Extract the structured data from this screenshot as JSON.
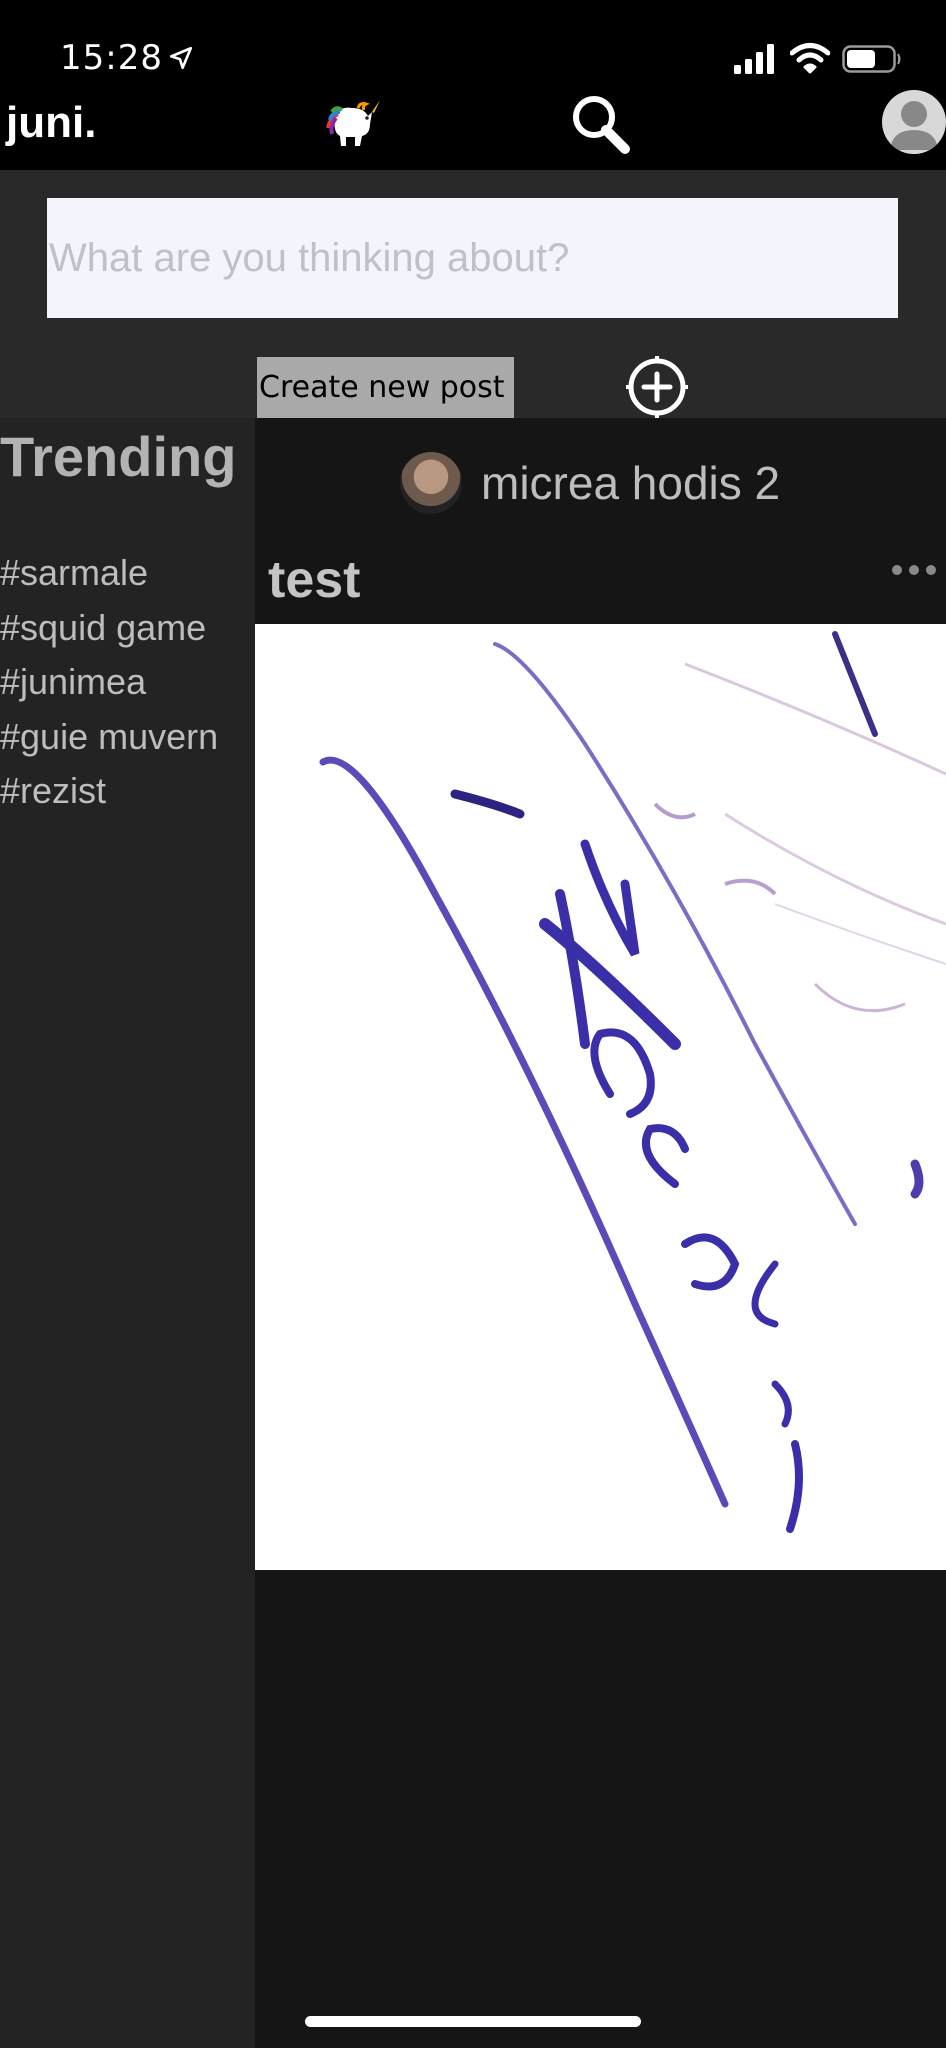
{
  "status_bar": {
    "time": "15:28"
  },
  "nav": {
    "brand": "juni."
  },
  "composer": {
    "placeholder": "What are you thinking about?",
    "create_label": "Create new post"
  },
  "sidebar": {
    "title": "Trending",
    "tags": [
      "#sarmale",
      "#squid game",
      "#junimea",
      "#guie muvern",
      "#rezist"
    ]
  },
  "post": {
    "author": "micrea hodis 2",
    "title": "test",
    "image_handwriting": "Hocteis"
  },
  "colors": {
    "background": "#232323",
    "feed": "#151515",
    "bar": "#000000",
    "button": "#a9a9a9",
    "ink": "#3a2fa8"
  }
}
